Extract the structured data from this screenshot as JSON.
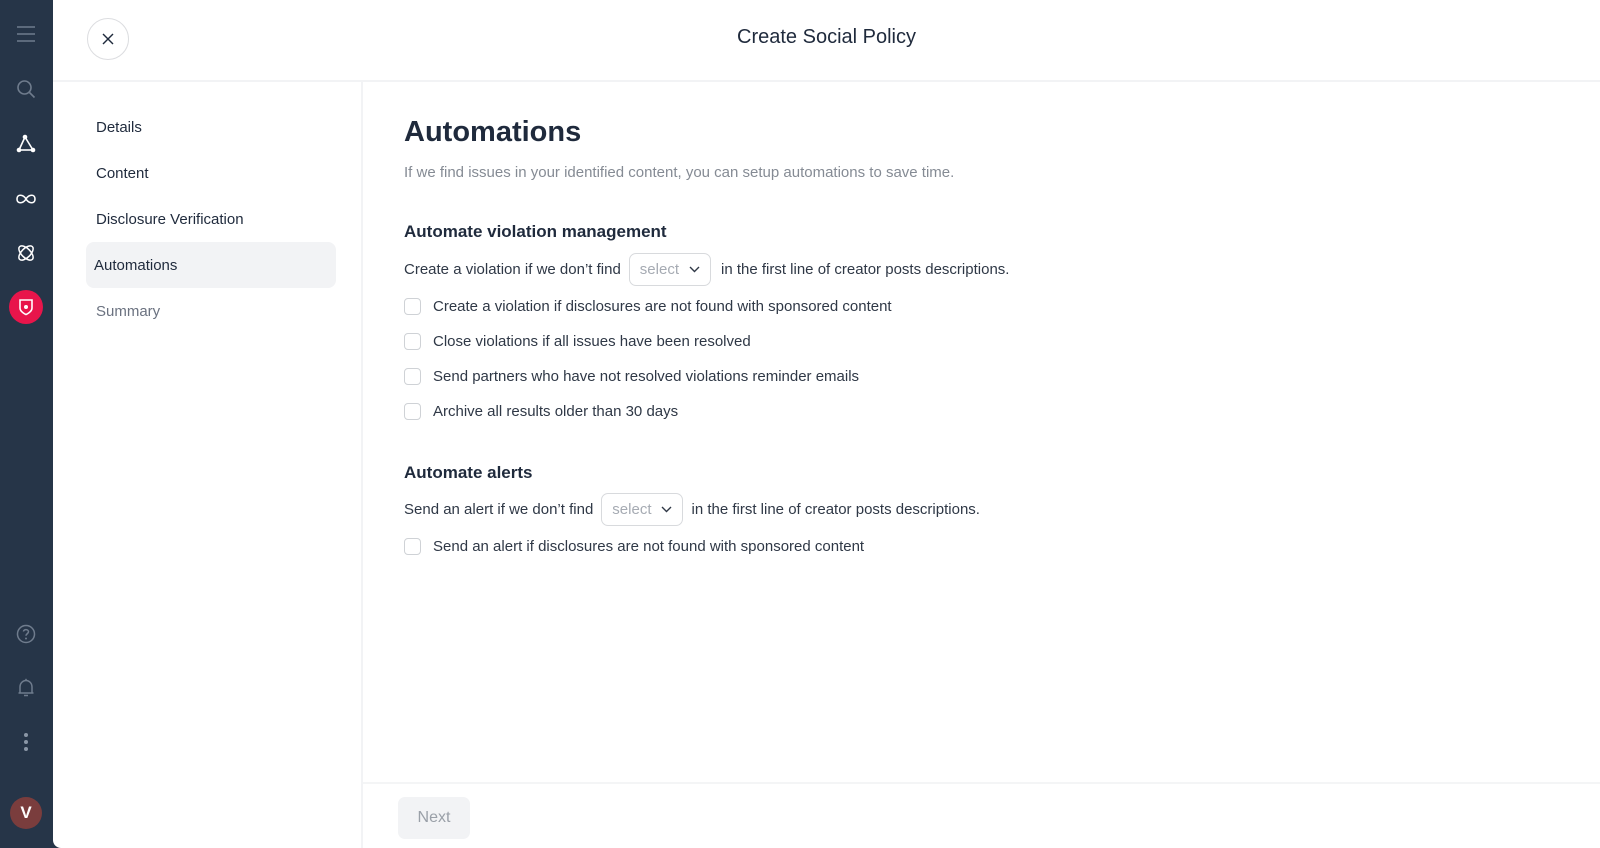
{
  "rail": {
    "icons": [
      "menu-icon",
      "search-icon",
      "network-icon",
      "infinity-icon",
      "atom-icon",
      "shield-icon"
    ],
    "bottom_icons": [
      "help-icon",
      "bell-icon",
      "more-vertical-icon"
    ],
    "avatar_initial": "V",
    "active_color": "#e8154b",
    "avatar_color": "#7a3d3d"
  },
  "header": {
    "title": "Create Social Policy",
    "close_icon": "close-icon"
  },
  "steps": [
    {
      "label": "Details",
      "state": "done"
    },
    {
      "label": "Content",
      "state": "done"
    },
    {
      "label": "Disclosure Verification",
      "state": "done"
    },
    {
      "label": "Automations",
      "state": "active"
    },
    {
      "label": "Summary",
      "state": "pending"
    }
  ],
  "main": {
    "title": "Automations",
    "subtitle": "If we find issues in your identified content, you can setup automations to save time.",
    "violation_section": {
      "heading": "Automate violation management",
      "prefix": "Create a violation if we don’t find",
      "select_placeholder": "select",
      "suffix": "in the first line of creator posts descriptions.",
      "checkboxes": [
        {
          "label": "Create a violation if disclosures are not found with sponsored content",
          "checked": false
        },
        {
          "label": "Close violations if all issues have been resolved",
          "checked": false
        },
        {
          "label": "Send partners who have not resolved violations reminder emails",
          "checked": false
        },
        {
          "label": "Archive all results older than 30 days",
          "checked": false
        }
      ]
    },
    "alerts_section": {
      "heading": "Automate alerts",
      "prefix": "Send an alert if we don’t find",
      "select_placeholder": "select",
      "suffix": "in the first line of creator posts descriptions.",
      "checkboxes": [
        {
          "label": "Send an alert if disclosures are not found with sponsored content",
          "checked": false
        }
      ]
    }
  },
  "footer": {
    "next_label": "Next"
  }
}
